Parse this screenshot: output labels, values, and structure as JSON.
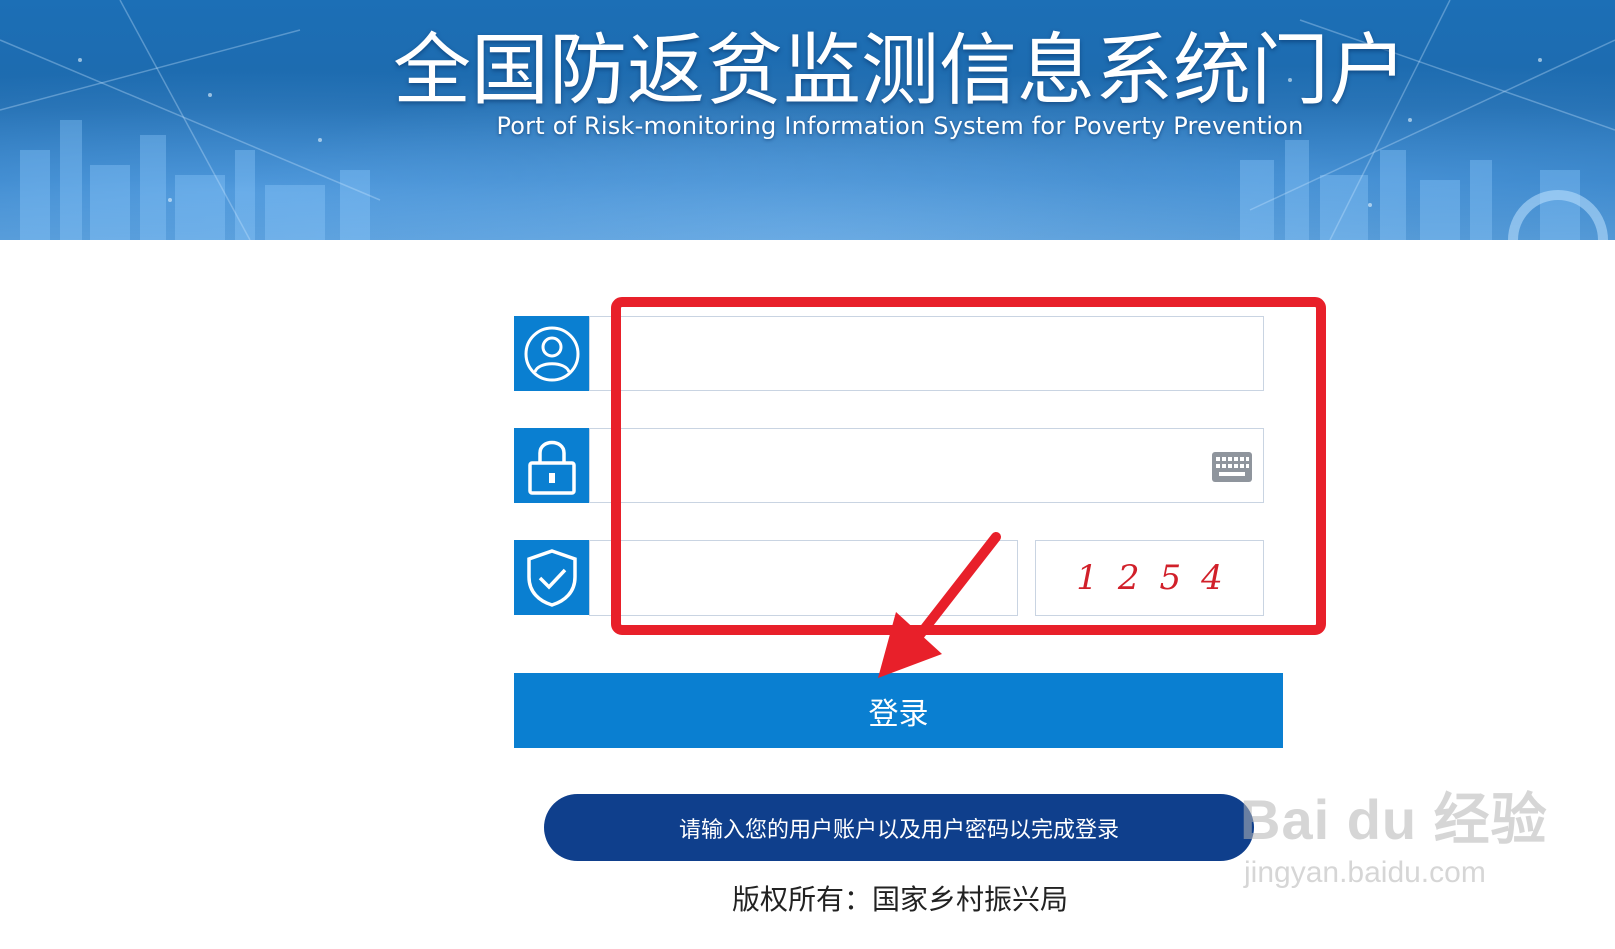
{
  "header": {
    "title": "全国防返贫监测信息系统门户",
    "subtitle": "Port of Risk-monitoring Information System for Poverty Prevention"
  },
  "form": {
    "username_value": "",
    "password_value": "",
    "captcha_value": "",
    "captcha_digits": [
      "1",
      "2",
      "5",
      "4"
    ]
  },
  "login_button": {
    "label": "登录"
  },
  "hint_text": "请输入您的用户账户以及用户密码以完成登录",
  "copyright": "版权所有：国家乡村振兴局",
  "watermark": {
    "brand": "Bai du 经验",
    "url": "jingyan.baidu.com"
  },
  "colors": {
    "accent": "#0a7fd1",
    "hint_bg": "#0f3f8c",
    "annotation_red": "#e8202a",
    "captcha_red": "#d1202a"
  },
  "icons": {
    "username": "user-icon",
    "password": "lock-icon",
    "captcha": "shield-check-icon",
    "keyboard": "keyboard-icon"
  }
}
